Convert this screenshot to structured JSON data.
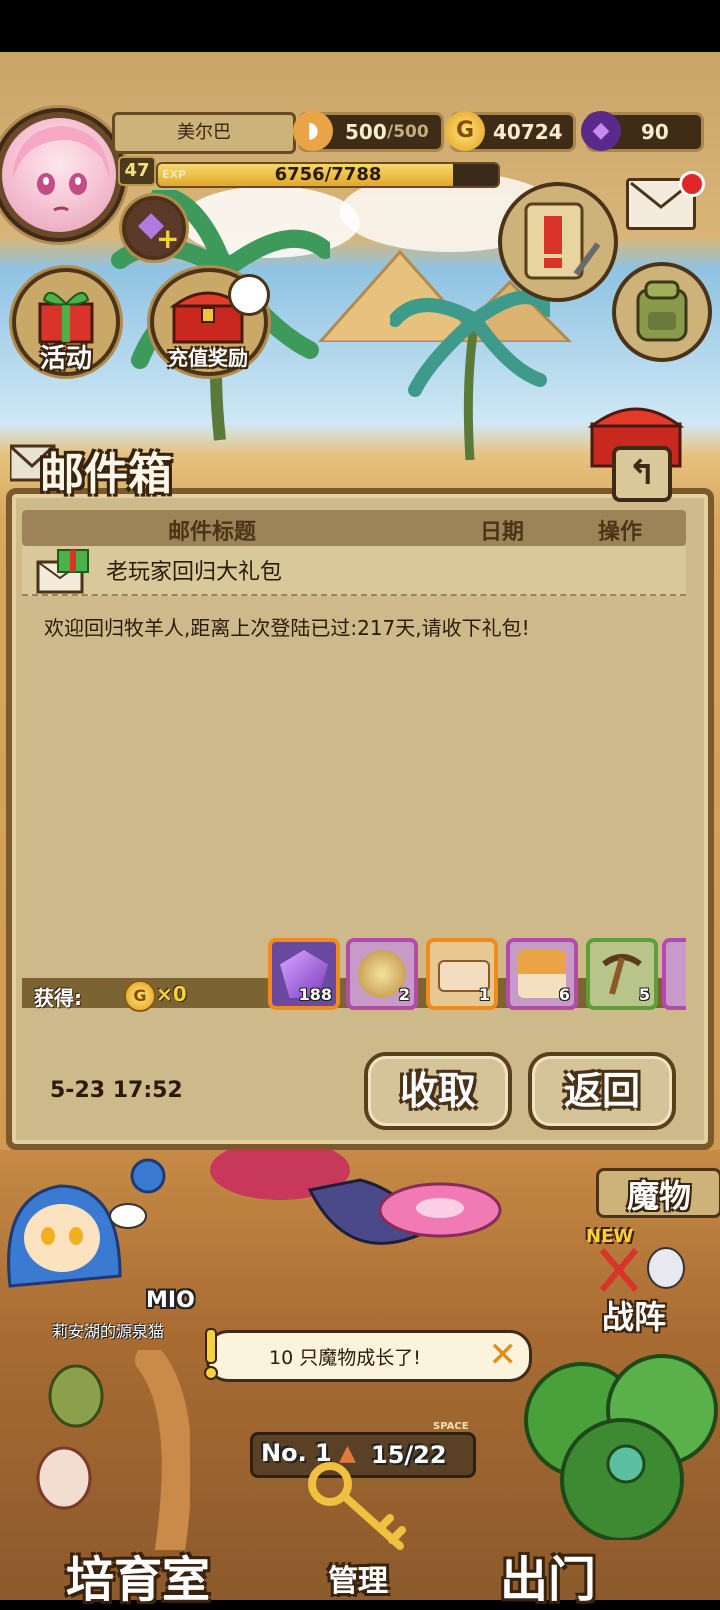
{
  "header": {
    "player_name": "美尔巴",
    "level": "47",
    "exp_label": "EXP",
    "exp_text": "6756/7788",
    "exp_fraction": 0.8675,
    "resources": {
      "bread_current": "500",
      "bread_max": "/500",
      "gold": "40724",
      "gems": "90"
    }
  },
  "scene_buttons": {
    "activity": "活动",
    "recharge_reward": "充值奖励"
  },
  "mail": {
    "panel_title": "邮件箱",
    "columns": [
      "邮件标题",
      "日期",
      "操作"
    ],
    "selected_title": "老玩家回归大礼包",
    "body": "欢迎回归牧羊人,距离上次登陆已过:217天,请收下礼包!",
    "obtain_label": "获得:",
    "coin_reward": "×0",
    "rewards": [
      {
        "icon": "purple-gem-icon",
        "count": "188",
        "color": "#f08a1a"
      },
      {
        "icon": "treasure-bag-icon",
        "count": "2",
        "color": "#b34ab0"
      },
      {
        "icon": "ticket-icon",
        "count": "1",
        "color": "#f08a1a"
      },
      {
        "icon": "bread-basket-icon",
        "count": "6",
        "color": "#b34ab0"
      },
      {
        "icon": "pickaxe-icon",
        "count": "5",
        "color": "#5aa03a"
      }
    ],
    "date": "5-23 17:52",
    "collect_button": "收取",
    "return_button": "返回"
  },
  "lower": {
    "monster_button": "魔物",
    "new_badge": "NEW",
    "formation_button": "战阵",
    "character_name": "MIO",
    "character_subtitle": "莉安湖的源泉猫",
    "notice_text": "10 只魔物成长了!",
    "rank_label": "No. 1",
    "space_label": "SPACE",
    "space_count": "15/22",
    "nursery": "培育室",
    "management": "管理",
    "exit": "出门"
  }
}
